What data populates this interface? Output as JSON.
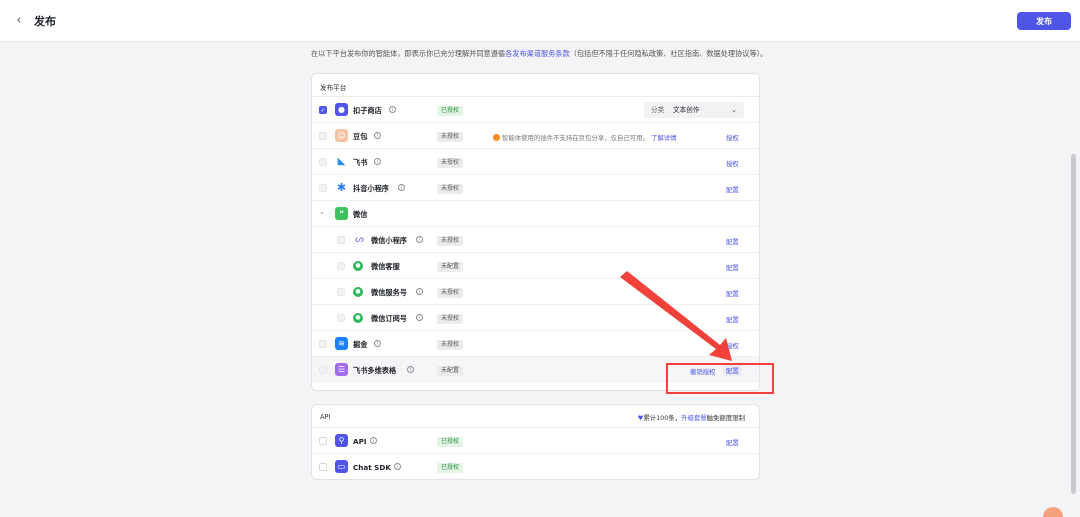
{
  "header": {
    "back_icon": "chevron-left-icon",
    "title": "发布",
    "publish_label": "发布"
  },
  "notice": {
    "prefix": "在以下平台发布你的智能体，即表示你已充分理解并同意遵循",
    "link": "各发布渠道服务条款",
    "suffix": "（包括但不限于任何隐私政策、社区指南、数据处理协议等）。"
  },
  "platforms": {
    "header": "发布平台",
    "category": {
      "label": "分类",
      "value": "文本创作"
    },
    "doubao_warning": {
      "text": "智能体使用的插件不支持在豆包分享，仅自己可用。",
      "link": "了解详情"
    },
    "items": [
      {
        "name": "扣子商店",
        "status": "已授权",
        "status_type": "ok",
        "action": "",
        "icon": "coze-store-icon",
        "icon_color": "#4e55e8",
        "checked": true
      },
      {
        "name": "豆包",
        "status": "未授权",
        "status_type": "no",
        "action": "授权",
        "icon": "doubao-icon",
        "icon_color": "#f4c3a3",
        "checked": false
      },
      {
        "name": "飞书",
        "status": "未授权",
        "status_type": "no",
        "action": "授权",
        "icon": "feishu-icon",
        "icon_color": "#1f8ff0",
        "checked": false
      },
      {
        "name": "抖音小程序",
        "status": "未授权",
        "status_type": "no",
        "action": "配置",
        "icon": "douyin-icon",
        "icon_color": "#2e7ef7",
        "checked": false
      },
      {
        "name": "微信",
        "status": "",
        "status_type": "",
        "action": "",
        "icon": "wechat-icon",
        "icon_color": "#3cc35e",
        "checked": false
      },
      {
        "name": "微信小程序",
        "status": "未授权",
        "status_type": "no",
        "action": "配置",
        "icon": "wechat-miniprogram-icon",
        "icon_color": "#6b6ff0",
        "checked": false
      },
      {
        "name": "微信客服",
        "status": "未配置",
        "status_type": "no",
        "action": "配置",
        "icon": "wechat-service-icon",
        "icon_color": "#2fb85a",
        "checked": false
      },
      {
        "name": "微信服务号",
        "status": "未授权",
        "status_type": "no",
        "action": "配置",
        "icon": "wechat-official-icon",
        "icon_color": "#2fb85a",
        "checked": false
      },
      {
        "name": "微信订阅号",
        "status": "未授权",
        "status_type": "no",
        "action": "配置",
        "icon": "wechat-subscription-icon",
        "icon_color": "#2fb85a",
        "checked": false
      },
      {
        "name": "掘金",
        "status": "未授权",
        "status_type": "no",
        "action": "授权",
        "icon": "juejin-icon",
        "icon_color": "#1e80ff",
        "checked": false
      },
      {
        "name": "飞书多维表格",
        "status": "未配置",
        "status_type": "no",
        "action": "配置",
        "extra_action": "撤销授权",
        "icon": "feishu-bitable-icon",
        "icon_color": "#a06cf0",
        "checked": false
      }
    ]
  },
  "api": {
    "header": "API",
    "quota_prefix": "累计100条，",
    "quota_link": "升级套餐",
    "quota_suffix": "触免额度限制",
    "items": [
      {
        "name": "API",
        "status": "已授权",
        "status_type": "ok",
        "action": "配置",
        "icon": "api-icon",
        "icon_color": "#4e55e8"
      },
      {
        "name": "Chat SDK",
        "status": "已授权",
        "status_type": "ok",
        "action": "",
        "icon": "chat-sdk-icon",
        "icon_color": "#4e55e8"
      }
    ]
  },
  "colors": {
    "accent": "#4e55e8",
    "annotation": "#f0413a",
    "ok": "#2c8a3c",
    "warning": "#ff8a1f"
  }
}
